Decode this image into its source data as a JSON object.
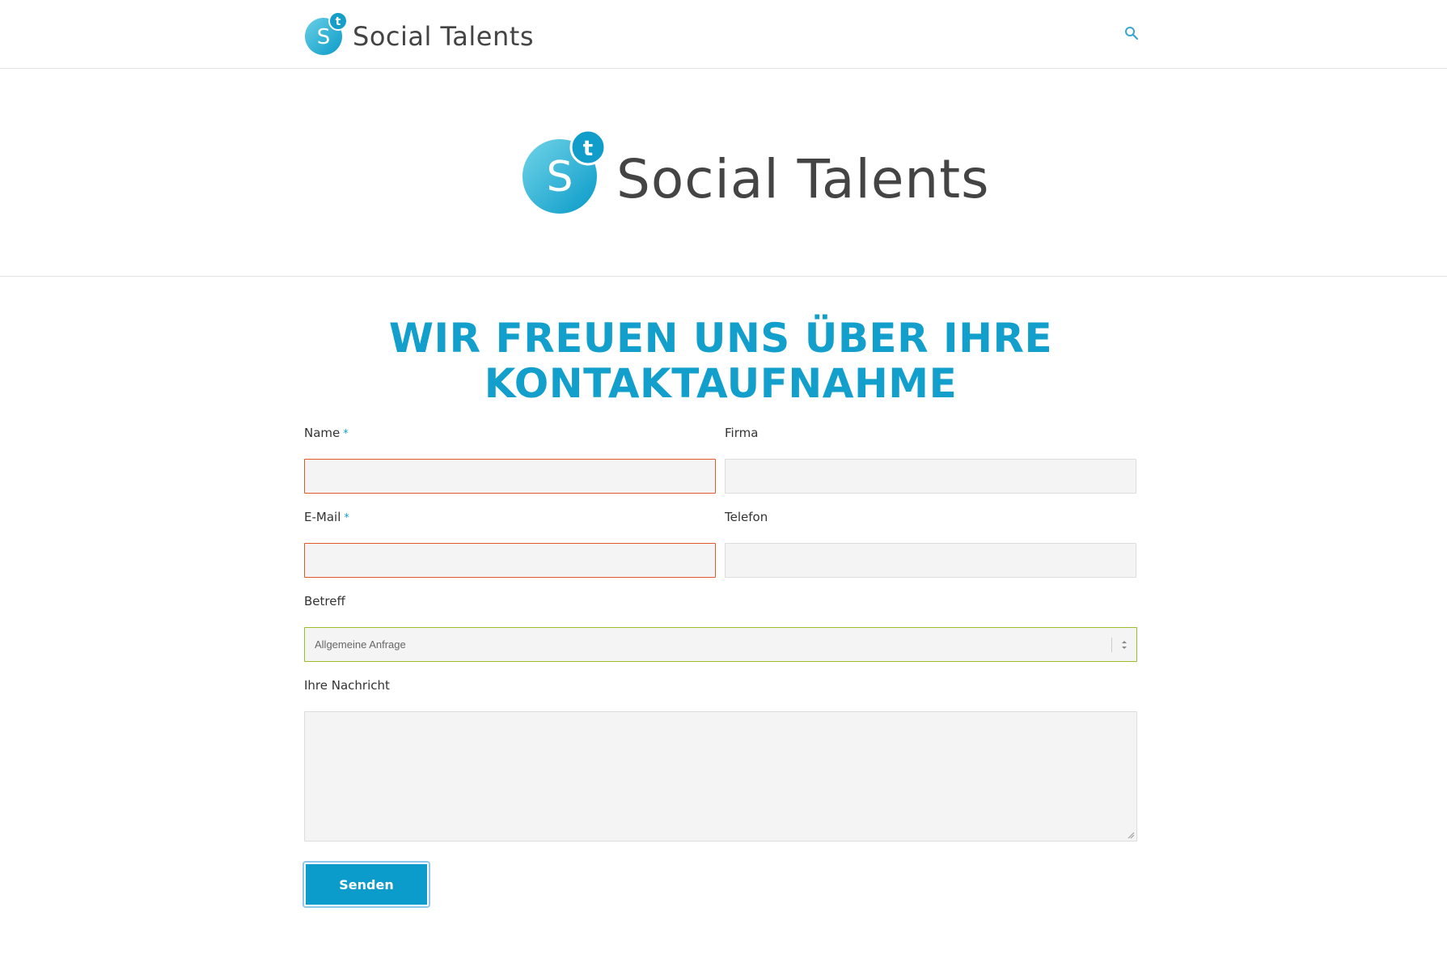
{
  "brand": {
    "name": "Social Talents",
    "mark_letter_main": "S",
    "mark_letter_sup": "t",
    "accent_color": "#129fcc"
  },
  "header": {
    "search_icon": "search-icon"
  },
  "page": {
    "title_line1": "Wir freuen uns über Ihre",
    "title_line2": "Kontaktaufnahme"
  },
  "form": {
    "name": {
      "label": "Name",
      "required_mark": "*",
      "value": ""
    },
    "company": {
      "label": "Firma",
      "value": ""
    },
    "email": {
      "label": "E-Mail",
      "required_mark": "*",
      "value": ""
    },
    "phone": {
      "label": "Telefon",
      "value": ""
    },
    "subject": {
      "label": "Betreff",
      "selected": "Allgemeine Anfrage"
    },
    "message": {
      "label": "Ihre Nachricht",
      "value": ""
    },
    "submit_label": "Senden",
    "error_border_color": "#e0592a",
    "valid_border_color": "#9bbd2b"
  }
}
